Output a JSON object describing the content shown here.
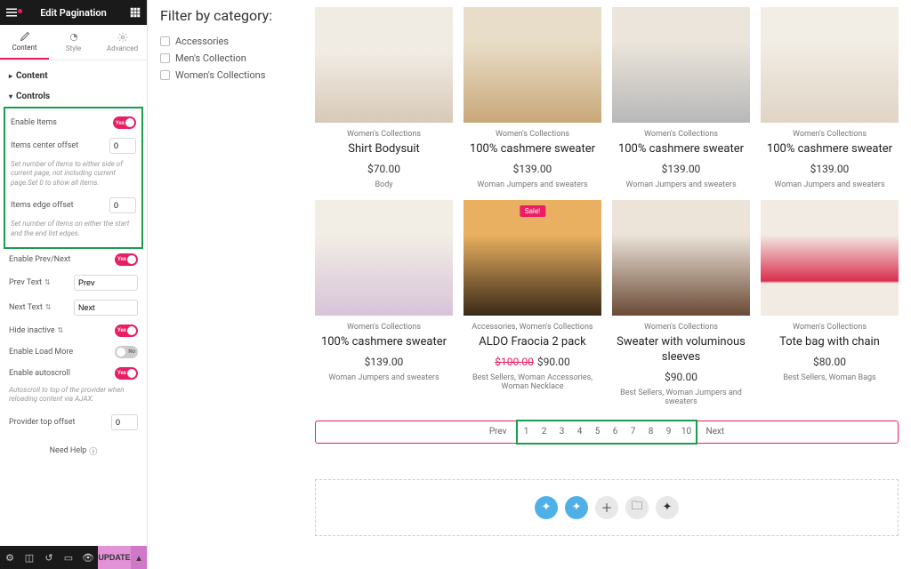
{
  "topbar": {
    "title": "Edit Pagination"
  },
  "tabs": {
    "content": "Content",
    "style": "Style",
    "advanced": "Advanced"
  },
  "sections": {
    "content_h": "Content",
    "controls_h": "Controls"
  },
  "controls": {
    "enable_items": "Enable Items",
    "items_center_offset": "Items center offset",
    "items_center_val": "0",
    "hint1": "Set number of items to either side of current page, not including current page.Set 0 to show all items.",
    "items_edge_offset": "Items edge offset",
    "items_edge_val": "0",
    "hint2": "Set number of items on either the start and the end list edges.",
    "enable_prev_next": "Enable Prev/Next",
    "prev_text": "Prev Text",
    "prev_val": "Prev",
    "next_text": "Next Text",
    "next_val": "Next",
    "hide_inactive": "Hide inactive",
    "enable_load_more": "Enable Load More",
    "enable_autoscroll": "Enable autoscroll",
    "hint3": "Autoscroll to top of the provider when reloading content via AJAX.",
    "provider_top_offset": "Provider top offset",
    "provider_top_val": "0",
    "yes": "Yes",
    "no": "No"
  },
  "need_help": "Need Help",
  "update": "UPDATE",
  "filter": {
    "title": "Filter by category:",
    "opts": [
      "Accessories",
      "Men's Collection",
      "Women's Collections"
    ]
  },
  "products": [
    {
      "cat": "Women's Collections",
      "title": "Shirt Bodysuit",
      "price": "$70.00",
      "tags": "Body",
      "img": "img1"
    },
    {
      "cat": "Women's Collections",
      "title": "100% cashmere sweater",
      "price": "$139.00",
      "tags": "Woman Jumpers and sweaters",
      "img": "img2"
    },
    {
      "cat": "Women's Collections",
      "title": "100% cashmere sweater",
      "price": "$139.00",
      "tags": "Woman Jumpers and sweaters",
      "img": "img3"
    },
    {
      "cat": "Women's Collections",
      "title": "100% cashmere sweater",
      "price": "$139.00",
      "tags": "Woman Jumpers and sweaters",
      "img": "img4"
    },
    {
      "cat": "Women's Collections",
      "title": "100% cashmere sweater",
      "price": "$139.00",
      "tags": "Woman Jumpers and sweaters",
      "img": "img5"
    },
    {
      "cat": "Accessories, Women's Collections",
      "title": "ALDO Fraocia 2 pack",
      "old": "$100.00",
      "price": "$90.00",
      "tags": "Best Sellers, Woman Accessories, Woman Necklace",
      "img": "img6",
      "sale": "Sale!"
    },
    {
      "cat": "Women's Collections",
      "title": "Sweater with voluminous sleeves",
      "price": "$90.00",
      "tags": "Best Sellers, Woman Jumpers and sweaters",
      "img": "img7"
    },
    {
      "cat": "Women's Collections",
      "title": "Tote bag with chain",
      "price": "$80.00",
      "tags": "Best Sellers, Woman Bags",
      "img": "img8"
    }
  ],
  "pagination": {
    "prev": "Prev",
    "next": "Next",
    "pages": [
      "1",
      "2",
      "3",
      "4",
      "5",
      "6",
      "7",
      "8",
      "9",
      "10"
    ]
  }
}
